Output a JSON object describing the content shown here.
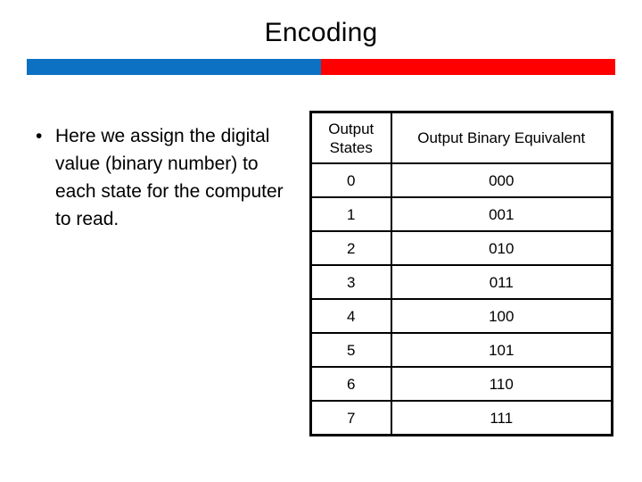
{
  "slide": {
    "title": "Encoding",
    "accent_bar": {
      "blue_color": "#0C71C3",
      "red_color": "#FF0000"
    },
    "body": {
      "bullets": [
        {
          "marker": "•",
          "text": "Here we assign the digital value (binary number) to each state for the computer to read."
        }
      ]
    },
    "table": {
      "headers": [
        "Output States",
        "Output Binary Equivalent"
      ],
      "rows": [
        {
          "state": "0",
          "binary": "000"
        },
        {
          "state": "1",
          "binary": "001"
        },
        {
          "state": "2",
          "binary": "010"
        },
        {
          "state": "3",
          "binary": "011"
        },
        {
          "state": "4",
          "binary": "100"
        },
        {
          "state": "5",
          "binary": "101"
        },
        {
          "state": "6",
          "binary": "110"
        },
        {
          "state": "7",
          "binary": "111"
        }
      ]
    }
  }
}
